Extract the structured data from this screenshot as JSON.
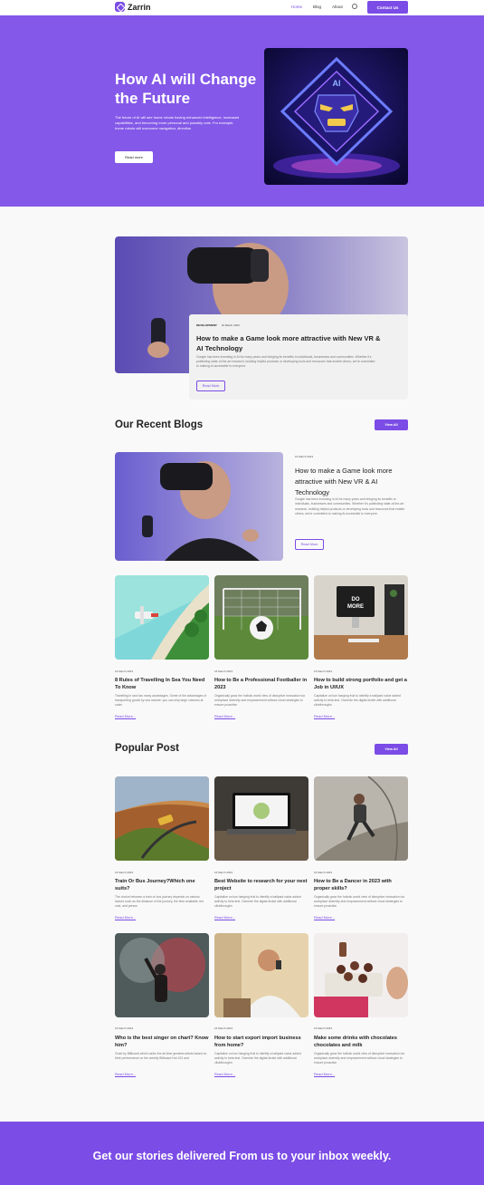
{
  "header": {
    "logo": "Zarrin",
    "nav": [
      "Home",
      "Blog",
      "About"
    ],
    "contact": "Contact Us"
  },
  "hero": {
    "title": "How AI will Change the Future",
    "description": "The future of AI will see home robots having enhanced intelligence, increased capabilities, and becoming more personal and possibly cute. For example, home robots will overcome navigation, direction",
    "button": "Read more",
    "badge": "AI"
  },
  "featured": {
    "category": "DEVELOPMENT",
    "date": "16 March 2023",
    "title": "How to make a Game look more attractive with New VR & AI Technology",
    "description": "Google has been investing in AI for many years and bringing its benefits to individuals, businesses and communities. Whether it's publishing state-of-the-art research, building helpful products or developing tools and resources that enable others, we're committed to making AI accessible to everyone.",
    "button": "Read More"
  },
  "recent": {
    "title": "Our Recent Blogs",
    "view_all": "View All",
    "highlight": {
      "date": "16 March 2023",
      "title": "How to make a Game look more attractive with New VR & AI Technology",
      "description": "Google has been investing in AI for many years and bringing its benefits to individuals, businesses and communities. Whether it's publishing state-of-the-art research, building helpful products or developing tools and resources that enable others, we're committed to making AI accessible to everyone.",
      "button": "Read More"
    },
    "cards": [
      {
        "date": "16 March 2023",
        "title": "8 Rules of Travelling In Sea You Need To Know",
        "description": "Travelling in sea has many advantages. Some of the advantages of transporting goods by sea include: you can ship large volumes at costs",
        "link": "Read More..."
      },
      {
        "date": "16 March 2023",
        "title": "How to Be a Professional Footballer in 2023",
        "description": "Organically grow the holistic world view of disruptive innovation via workplace diversity and empowerment without cloud strategies to ensure proactive",
        "link": "Read More..."
      },
      {
        "date": "16 March 2023",
        "title": "How to build strong portfolio and get a Job in UI/UX",
        "description": "Capitalize on low hanging fruit to identify a ballpark value added activity to beta test. Override the digital divide with additional clickthroughs",
        "link": "Read More..."
      }
    ]
  },
  "popular": {
    "title": "Popular Post",
    "view_all": "View All",
    "cards": [
      {
        "date": "16 March 2023",
        "title": "Train Or Bus Journey?Which one suits?",
        "description": "The choice between a train or bus journey depends on various factors such as the distance of the journey, the time available, the cost, and person",
        "link": "Read More..."
      },
      {
        "date": "16 March 2023",
        "title": "Best Website to research for your next project",
        "description": "Capitalize on low hanging fruit to identify a ballpark value added activity to beta test. Override the digital divide with additional clickthroughs",
        "link": "Read More..."
      },
      {
        "date": "16 March 2023",
        "title": "How to Be a Dancer in 2023 with proper skills?",
        "description": "Organically grow the holistic world view of disruptive innovation via workplace diversity and empowerment without cloud strategies to ensure proactive",
        "link": "Read More..."
      },
      {
        "date": "16 March 2023",
        "title": "Who is the best singer on chart? Know him?",
        "description": "Chart by Billboard which ranks the all-time greatest artists based on their performance on the weekly Billboard Hot 100 and",
        "link": "Read More..."
      },
      {
        "date": "16 March 2023",
        "title": "How to start export import business from home?",
        "description": "Capitalize on low hanging fruit to identify a ballpark value added activity to beta test. Override the digital divide with additional clickthroughs",
        "link": "Read More..."
      },
      {
        "date": "16 March 2023",
        "title": "Make some drinks with chocolates chocolates and milk",
        "description": "Organically grow the holistic world view of disruptive innovation via workplace diversity and empowerment without cloud strategies to ensure proactive",
        "link": "Read More..."
      }
    ]
  },
  "footer": {
    "title": "Get our stories delivered From us to your inbox weekly."
  },
  "colors": {
    "accent": "#7b4ce6",
    "hero_bg": "#8458e8"
  }
}
